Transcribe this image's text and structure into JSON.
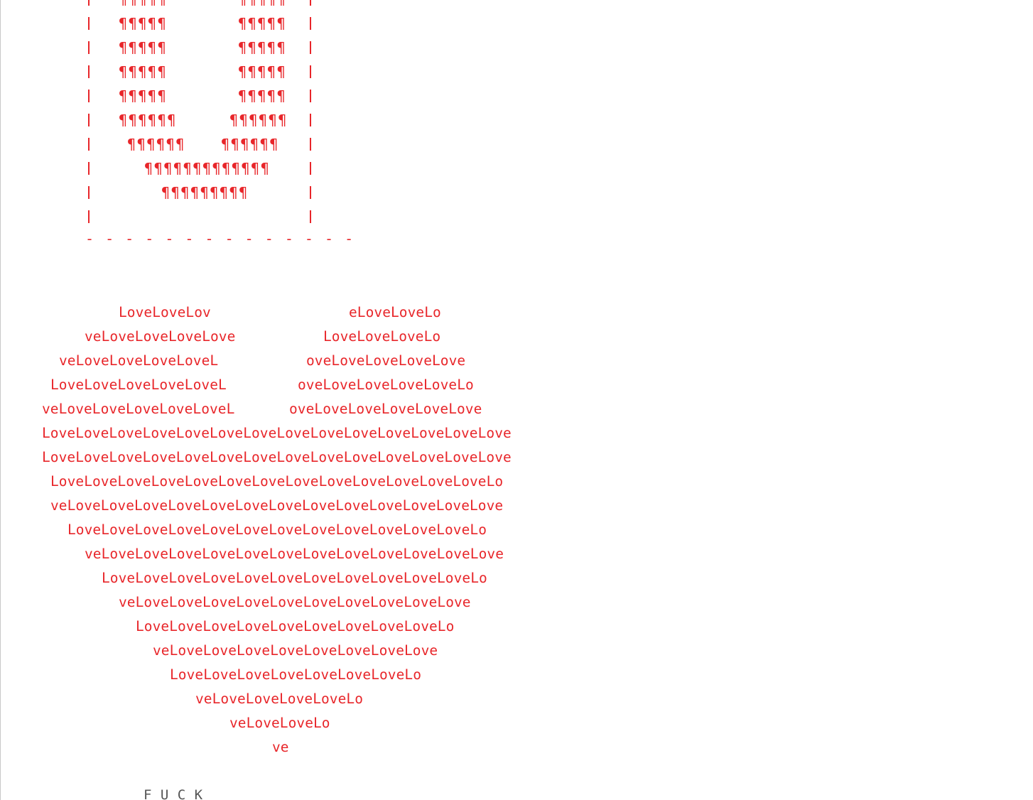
{
  "colors": {
    "art": "#e8262a",
    "footer": "#555555",
    "background": "#ffffff"
  },
  "box": {
    "top_partial": "¶¶¶¶¶",
    "rows": [
      {
        "left": "¶¶¶¶¶",
        "right": "¶¶¶¶¶"
      },
      {
        "left": "¶¶¶¶¶",
        "right": "¶¶¶¶¶"
      },
      {
        "left": "¶¶¶¶¶",
        "right": "¶¶¶¶¶"
      },
      {
        "left": "¶¶¶¶¶",
        "right": "¶¶¶¶¶"
      },
      {
        "left": "¶¶¶¶¶¶",
        "right": "¶¶¶¶¶¶"
      },
      {
        "left": "¶¶¶¶¶¶",
        "right": "¶¶¶¶¶¶"
      },
      {
        "center": "¶¶¶¶¶¶¶¶¶¶¶¶¶"
      },
      {
        "center": "¶¶¶¶¶¶¶¶¶"
      },
      {
        "center": ""
      }
    ],
    "bottom_border": "- - - - - - - - - - - - - -"
  },
  "heart": {
    "lines": [
      "LoveLoveLov",
      "eLoveLoveLo",
      "veLoveLoveLoveLove",
      "LoveLoveLoveLo",
      "veLoveLoveLoveLoveL",
      "oveLoveLoveLoveLove",
      "LoveLoveLoveLoveLoveL",
      "oveLoveLoveLoveLoveLo",
      "veLoveLoveLoveLoveLoveL",
      "oveLoveLoveLoveLoveLove",
      "LoveLoveLoveLoveLoveLoveLoveLoveLoveLoveLoveLoveLoveLove",
      "LoveLoveLoveLoveLoveLoveLoveLoveLoveLoveLoveLoveLoveLove",
      "LoveLoveLoveLoveLoveLoveLoveLoveLoveLoveLoveLoveLoveLo",
      "veLoveLoveLoveLoveLoveLoveLoveLoveLoveLoveLoveLoveLove",
      "LoveLoveLoveLoveLoveLoveLoveLoveLoveLoveLoveLoveLo",
      "veLoveLoveLoveLoveLoveLoveLoveLoveLoveLoveLoveLove",
      "LoveLoveLoveLoveLoveLoveLoveLoveLoveLoveLoveLo",
      "veLoveLoveLoveLoveLoveLoveLoveLoveLoveLove",
      "LoveLoveLoveLoveLoveLoveLoveLoveLoveLo",
      "veLoveLoveLoveLoveLoveLoveLoveLove",
      "LoveLoveLoveLoveLoveLoveLoveLo",
      "veLoveLoveLoveLoveLo",
      "veLoveLoveLo",
      "ve"
    ]
  },
  "footer": {
    "text": "F U C K"
  }
}
